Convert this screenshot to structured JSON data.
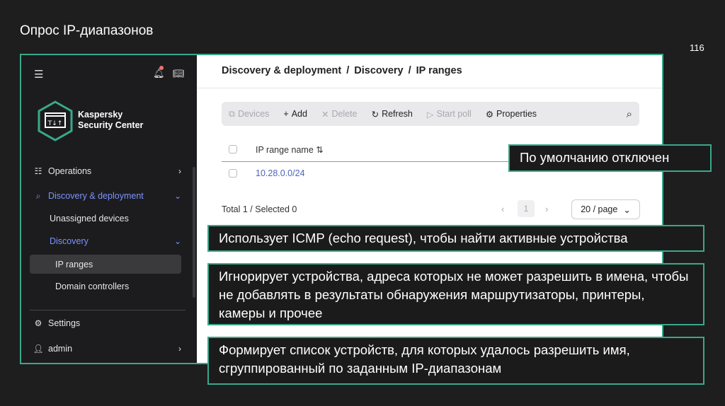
{
  "slide": {
    "title": "Опрос IP-диапазонов",
    "page_number": "116"
  },
  "app": {
    "logo": {
      "line1": "Kaspersky",
      "line2": "Security Center"
    },
    "sidebar": {
      "items": [
        {
          "label": "Operations"
        },
        {
          "label": "Discovery & deployment"
        },
        {
          "label": "Unassigned devices"
        },
        {
          "label": "Discovery"
        },
        {
          "label": "IP ranges"
        },
        {
          "label": "Domain controllers"
        },
        {
          "label": "Settings"
        },
        {
          "label": "admin"
        }
      ]
    },
    "breadcrumb": [
      "Discovery & deployment",
      "/",
      "Discovery",
      "/",
      "IP ranges"
    ],
    "toolbar": {
      "devices": "Devices",
      "add": "Add",
      "delete": "Delete",
      "refresh": "Refresh",
      "start_poll": "Start poll",
      "properties": "Properties"
    },
    "table": {
      "header": "IP range name",
      "sort_icon": "⇅",
      "rows": [
        "10.28.0.0/24"
      ]
    },
    "footer": {
      "total": "Total 1 / Selected 0",
      "page": "1",
      "per_page": "20 / page"
    }
  },
  "callouts": [
    "По умолчанию отключен",
    "Использует ICMP (echo request), чтобы найти активные устройства",
    "Игнорирует устройства, адреса которых не может разрешить в имена, чтобы не добавлять в результаты обнаружения маршрутизаторы, принтеры, камеры и прочее",
    "Формирует список устройств, для которых удалось разрешить имя, сгруппированный по заданным IP-диапазонам"
  ]
}
